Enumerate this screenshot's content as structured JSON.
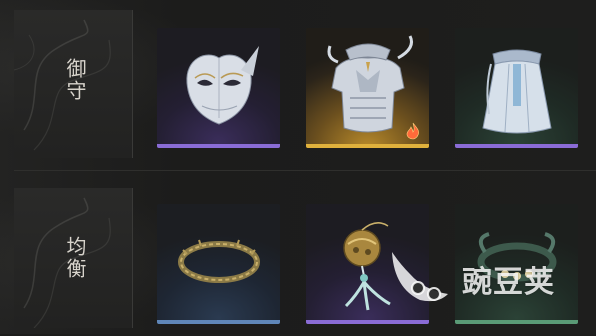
{
  "rows": [
    {
      "label": "御守",
      "slots": [
        {
          "item_icon": "silver-mask-icon",
          "rarity_color": "#8a6cd6"
        },
        {
          "item_icon": "silver-armor-icon",
          "rarity_color": "#e0b13c",
          "badge_icon": "flame-icon"
        },
        {
          "item_icon": "silver-robe-skirt-icon",
          "rarity_color": "#8a6cd6"
        }
      ]
    },
    {
      "label": "均衡",
      "slots": [
        {
          "item_icon": "bronze-ring-icon",
          "rarity_color": "#5f86b8"
        },
        {
          "item_icon": "bell-tassel-charm-icon",
          "rarity_color": "#8a6cd6"
        },
        {
          "item_icon": "jade-bracelet-icon",
          "rarity_color": "#5a9a76"
        }
      ]
    }
  ],
  "watermark": {
    "text": "豌豆荚"
  }
}
